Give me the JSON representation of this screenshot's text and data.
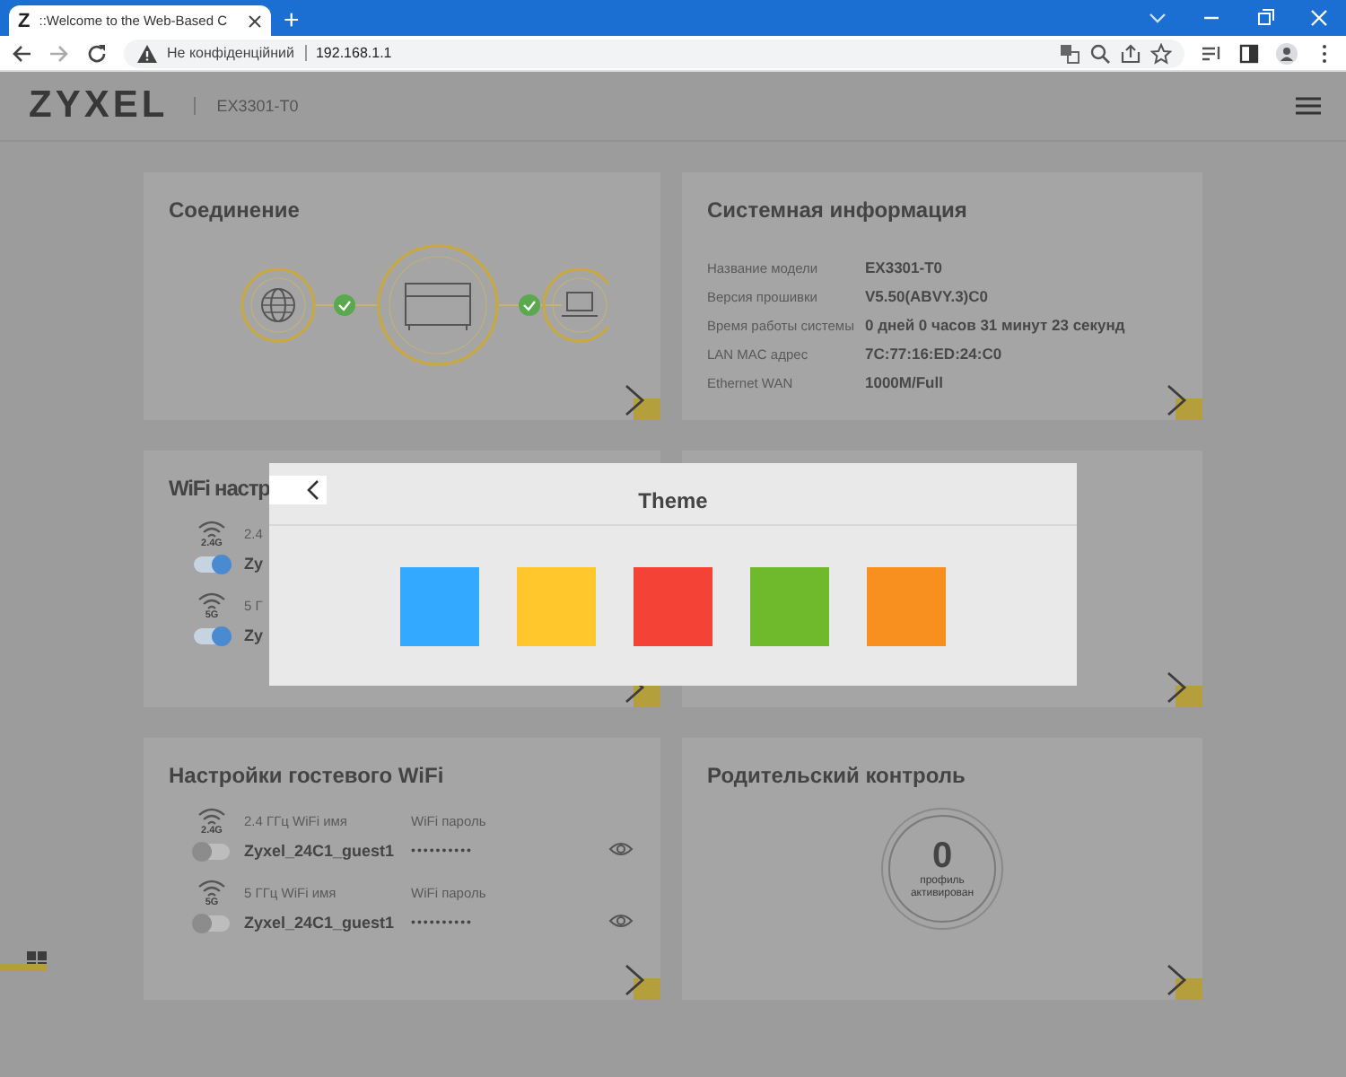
{
  "browser": {
    "tab_icon": "Z",
    "tab_title": "::Welcome to the Web-Based C",
    "new_tab": "+",
    "security_label": "Не конфіденційний",
    "url": "192.168.1.1"
  },
  "header": {
    "logo": "ZYXEL",
    "model": "EX3301-T0"
  },
  "connection_card": {
    "title": "Соединение"
  },
  "system_info_card": {
    "title": "Системная информация",
    "rows": [
      {
        "label": "Название модели",
        "value": "EX3301-T0"
      },
      {
        "label": "Версия прошивки",
        "value": "V5.50(ABVY.3)C0"
      },
      {
        "label": "Время работы системы",
        "value": "0 дней 0 часов 31 минут 23 секунд"
      },
      {
        "label": "LAN MAC адрес",
        "value": "7C:77:16:ED:24:C0"
      },
      {
        "label": "Ethernet WAN",
        "value": "1000M/Full"
      }
    ]
  },
  "wifi_card": {
    "title": "WiFi настр",
    "networks": [
      {
        "band": "2.4G",
        "on": true,
        "name_label": "2.4",
        "name": "Zy"
      },
      {
        "band": "5G",
        "on": true,
        "name_label": "5 Г",
        "name": "Zy"
      }
    ]
  },
  "guest_wifi_card": {
    "title": "Настройки гостевого WiFi",
    "networks": [
      {
        "band": "2.4G",
        "on": false,
        "name_label": "2.4 ГГц WiFi имя",
        "name": "Zyxel_24C1_guest1",
        "password_label": "WiFi пароль",
        "password": "••••••••••"
      },
      {
        "band": "5G",
        "on": false,
        "name_label": "5 ГГц WiFi имя",
        "name": "Zyxel_24C1_guest1",
        "password_label": "WiFi пароль",
        "password": "••••••••••"
      }
    ]
  },
  "parental_card": {
    "title": "Родительский контроль",
    "count": "0",
    "caption": "профиль активирован"
  },
  "theme_dialog": {
    "title": "Theme",
    "colors": [
      {
        "color": "#33aaff"
      },
      {
        "color": "#ffc72c"
      },
      {
        "color": "#f44336"
      },
      {
        "color": "#6fba2c"
      },
      {
        "color": "#f7901e"
      }
    ]
  }
}
